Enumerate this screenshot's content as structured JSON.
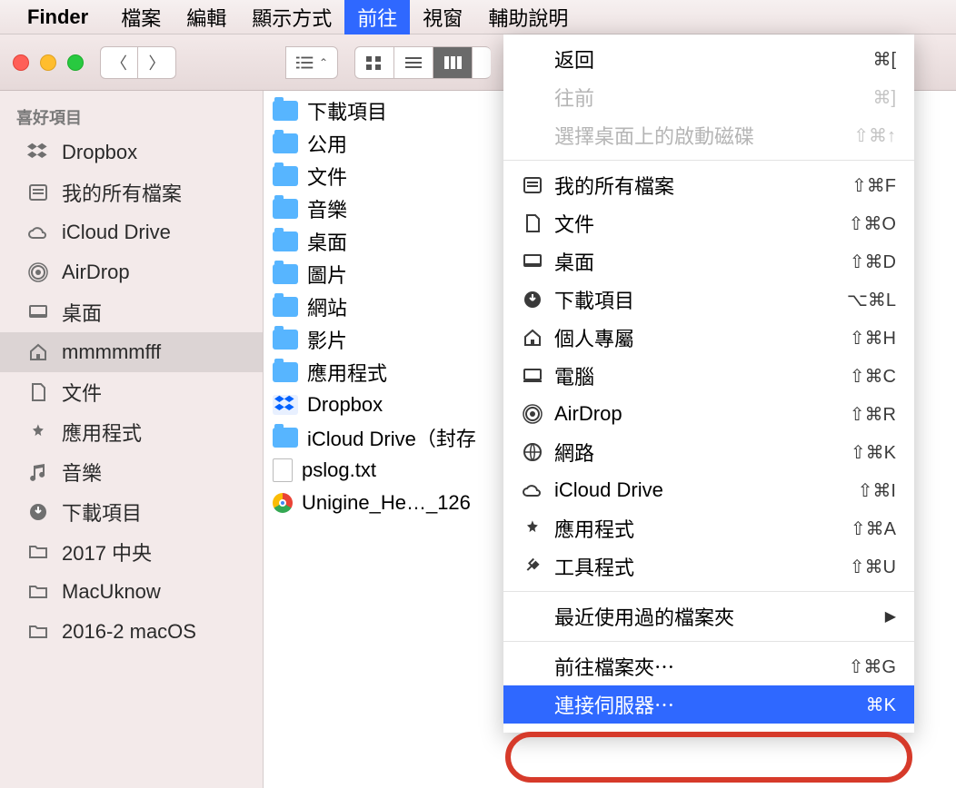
{
  "menubar": {
    "app": "Finder",
    "items": [
      "檔案",
      "編輯",
      "顯示方式",
      "前往",
      "視窗",
      "輔助說明"
    ],
    "active_index": 3
  },
  "sidebar": {
    "section": "喜好項目",
    "items": [
      {
        "icon": "dropbox",
        "label": "Dropbox"
      },
      {
        "icon": "allfiles",
        "label": "我的所有檔案"
      },
      {
        "icon": "cloud",
        "label": "iCloud Drive"
      },
      {
        "icon": "airdrop",
        "label": "AirDrop"
      },
      {
        "icon": "desktop",
        "label": "桌面"
      },
      {
        "icon": "home",
        "label": "mmmmmfff",
        "selected": true
      },
      {
        "icon": "doc",
        "label": "文件"
      },
      {
        "icon": "apps",
        "label": "應用程式"
      },
      {
        "icon": "music",
        "label": "音樂"
      },
      {
        "icon": "download",
        "label": "下載項目"
      },
      {
        "icon": "folder",
        "label": "2017 中央"
      },
      {
        "icon": "folder",
        "label": "MacUknow"
      },
      {
        "icon": "folder",
        "label": "2016-2 macOS"
      }
    ]
  },
  "files": [
    {
      "icon": "folder-dl",
      "label": "下載項目"
    },
    {
      "icon": "folder-pub",
      "label": "公用"
    },
    {
      "icon": "folder",
      "label": "文件"
    },
    {
      "icon": "folder-music",
      "label": "音樂"
    },
    {
      "icon": "folder",
      "label": "桌面"
    },
    {
      "icon": "folder-pic",
      "label": "圖片"
    },
    {
      "icon": "folder",
      "label": "網站"
    },
    {
      "icon": "folder-mov",
      "label": "影片"
    },
    {
      "icon": "folder-app",
      "label": "應用程式"
    },
    {
      "icon": "dropbox",
      "label": "Dropbox"
    },
    {
      "icon": "folder",
      "label": "iCloud Drive（封存"
    },
    {
      "icon": "txt",
      "label": "pslog.txt"
    },
    {
      "icon": "chrome",
      "label": "Unigine_He…_126"
    }
  ],
  "dropdown": {
    "groups": [
      [
        {
          "label": "返回",
          "shortcut": "⌘["
        },
        {
          "label": "往前",
          "shortcut": "⌘]",
          "disabled": true
        },
        {
          "label": "選擇桌面上的啟動磁碟",
          "shortcut": "⇧⌘↑",
          "disabled": true
        }
      ],
      [
        {
          "icon": "allfiles",
          "label": "我的所有檔案",
          "shortcut": "⇧⌘F"
        },
        {
          "icon": "doc",
          "label": "文件",
          "shortcut": "⇧⌘O"
        },
        {
          "icon": "desktop",
          "label": "桌面",
          "shortcut": "⇧⌘D"
        },
        {
          "icon": "download",
          "label": "下載項目",
          "shortcut": "⌥⌘L"
        },
        {
          "icon": "home",
          "label": "個人專屬",
          "shortcut": "⇧⌘H"
        },
        {
          "icon": "computer",
          "label": "電腦",
          "shortcut": "⇧⌘C"
        },
        {
          "icon": "airdrop",
          "label": "AirDrop",
          "shortcut": "⇧⌘R"
        },
        {
          "icon": "network",
          "label": "網路",
          "shortcut": "⇧⌘K"
        },
        {
          "icon": "cloud",
          "label": "iCloud Drive",
          "shortcut": "⇧⌘I"
        },
        {
          "icon": "apps",
          "label": "應用程式",
          "shortcut": "⇧⌘A"
        },
        {
          "icon": "utils",
          "label": "工具程式",
          "shortcut": "⇧⌘U"
        }
      ],
      [
        {
          "label": "最近使用過的檔案夾",
          "submenu": true
        }
      ],
      [
        {
          "label": "前往檔案夾⋯",
          "shortcut": "⇧⌘G"
        },
        {
          "label": "連接伺服器⋯",
          "shortcut": "⌘K",
          "selected": true
        }
      ]
    ]
  }
}
